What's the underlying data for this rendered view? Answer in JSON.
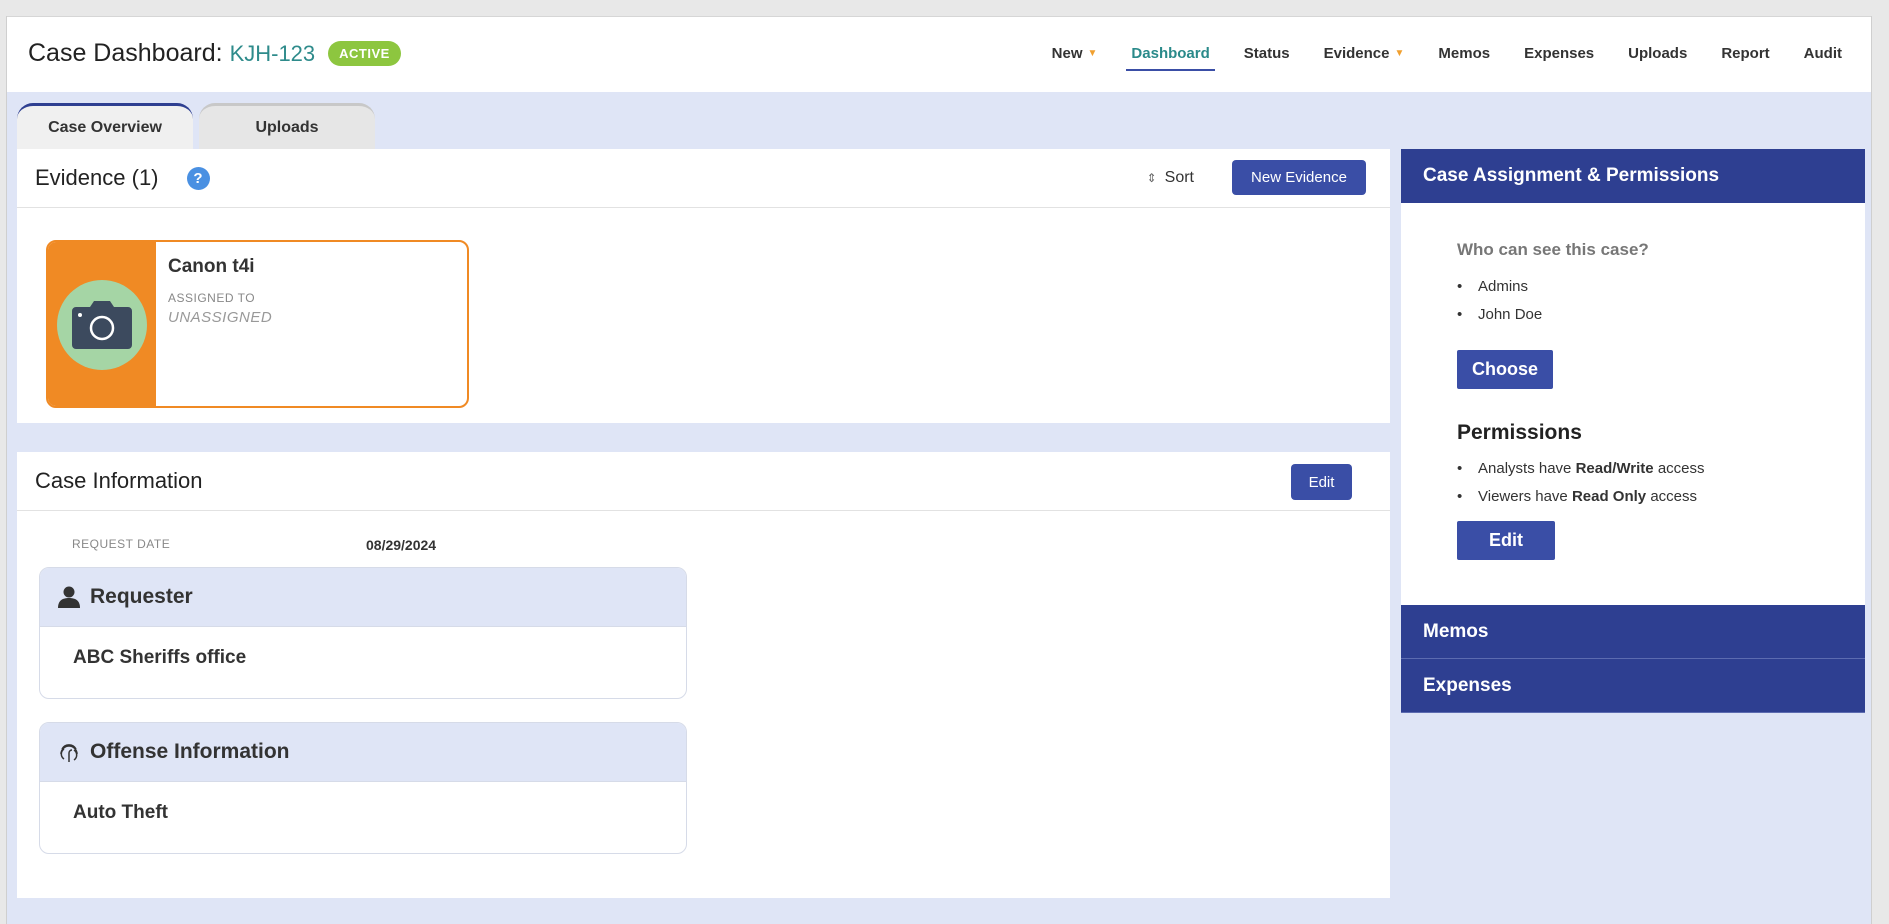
{
  "header": {
    "title": "Case Dashboard:",
    "case_id": "KJH-123",
    "status": "ACTIVE",
    "nav": [
      "New",
      "Dashboard",
      "Status",
      "Evidence",
      "Memos",
      "Expenses",
      "Uploads",
      "Report",
      "Audit"
    ]
  },
  "tabs": [
    "Case Overview",
    "Uploads"
  ],
  "evidence": {
    "title": "Evidence (1)",
    "help": "?",
    "sort_label": "Sort",
    "new_button": "New Evidence",
    "item": {
      "name": "Canon t4i",
      "assigned_label": "ASSIGNED TO",
      "assigned_value": "UNASSIGNED"
    }
  },
  "case_info": {
    "title": "Case Information",
    "edit_button": "Edit",
    "request_date_label": "REQUEST DATE",
    "request_date_value": "08/29/2024",
    "requester_title": "Requester",
    "requester_value": "ABC Sheriffs office",
    "offense_title": "Offense Information",
    "offense_value": "Auto Theft"
  },
  "side": {
    "title": "Case Assignment & Permissions",
    "who_label": "Who can see this case?",
    "who_list": [
      "Admins",
      "John Doe"
    ],
    "choose_button": "Choose",
    "permissions_title": "Permissions",
    "perm1_prefix": "Analysts have",
    "perm1_bold": "Read/Write",
    "perm1_suffix": "access",
    "perm2_prefix": "Viewers have",
    "perm2_bold": "Read Only",
    "perm2_suffix": "access",
    "edit_button": "Edit",
    "memos": "Memos",
    "expenses": "Expenses"
  }
}
